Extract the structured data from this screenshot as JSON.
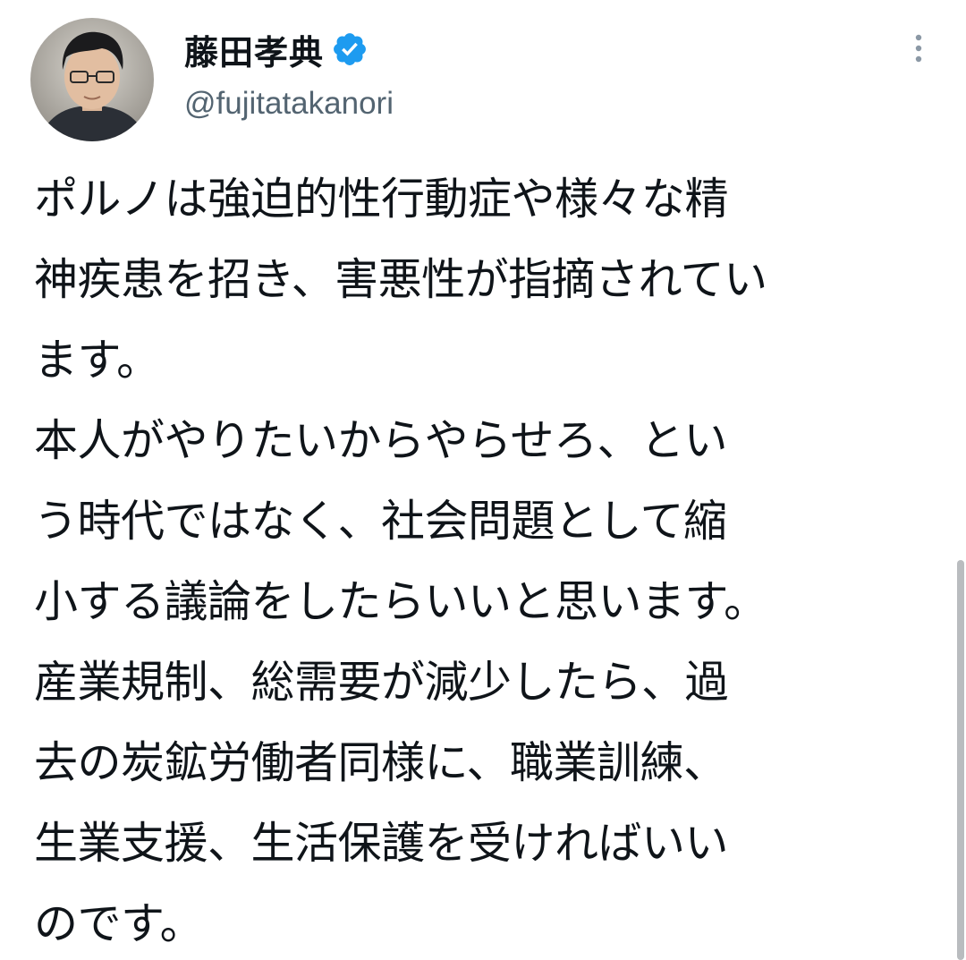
{
  "author": {
    "display_name": "藤田孝典",
    "handle": "@fujitatakanori",
    "verified": true,
    "verified_color": "#1d9bf0"
  },
  "icons": {
    "verified": "verified-badge-icon",
    "more": "more-vertical-icon",
    "avatar": "profile-photo"
  },
  "tweet": {
    "lines": [
      "ポルノは強迫的性行動症や様々な精",
      "神疾患を招き、害悪性が指摘されてい",
      "ます。",
      "本人がやりたいからやらせろ、とい",
      "う時代ではなく、社会問題として縮",
      "小する議論をしたらいいと思います。",
      "産業規制、総需要が減少したら、過",
      "去の炭鉱労働者同様に、職業訓練、",
      "生業支援、生活保護を受ければいい",
      "のです。"
    ]
  },
  "colors": {
    "text": "#0f1419",
    "secondary_text": "#536471",
    "background": "#ffffff"
  }
}
